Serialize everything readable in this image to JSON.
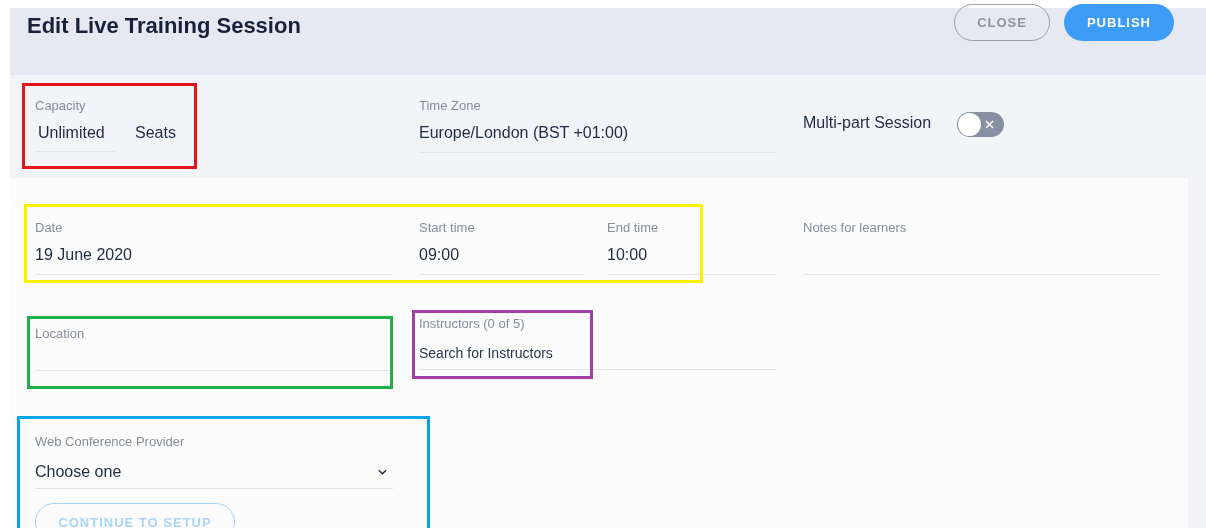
{
  "header": {
    "title": "Edit Live Training Session",
    "buttons": [
      {
        "label": "CLOSE",
        "kind": "outline"
      },
      {
        "label": "PUBLISH",
        "kind": "primary"
      }
    ]
  },
  "capacity": {
    "label": "Capacity",
    "value": "Unlimited",
    "unit": "Seats"
  },
  "time_zone": {
    "label": "Time Zone",
    "value": "Europe/London (BST +01:00)"
  },
  "multi_part": {
    "label": "Multi-part Session",
    "on": false
  },
  "date": {
    "label": "Date",
    "value": "19 June 2020"
  },
  "start_time": {
    "label": "Start time",
    "value": "09:00"
  },
  "end_time": {
    "label": "End time",
    "value": "10:00"
  },
  "notes": {
    "label": "Notes for learners"
  },
  "location": {
    "label": "Location"
  },
  "instructors": {
    "label": "Instructors (0 of 5)",
    "placeholder": "Search for Instructors"
  },
  "web_conference": {
    "label": "Web Conference Provider",
    "value": "Choose one",
    "button": "CONTINUE TO SETUP"
  },
  "highlights": [
    {
      "color": "#e8141c"
    },
    {
      "color": "#fff200"
    },
    {
      "color": "#1db34a"
    },
    {
      "color": "#a03fa8"
    },
    {
      "color": "#09a6e6"
    }
  ]
}
